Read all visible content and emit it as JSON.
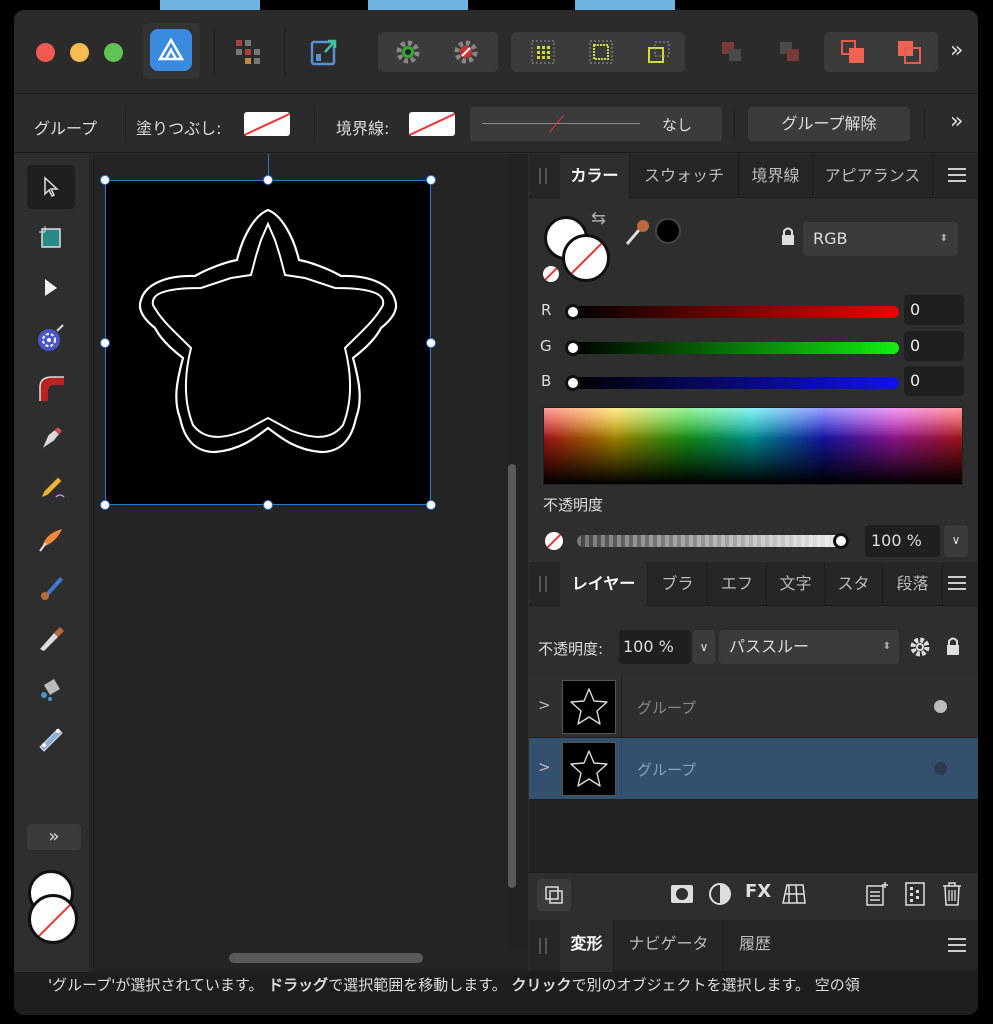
{
  "toolbar": {
    "overflow_label": "»"
  },
  "context_bar": {
    "object_label": "グループ",
    "fill_label": "塗りつぶし:",
    "stroke_label": "境界線:",
    "stroke_style_value": "なし",
    "ungroup_button": "グループ解除",
    "overflow_label": "»"
  },
  "tools": {
    "expand_label": "»"
  },
  "color_panel": {
    "tabs": [
      "カラー",
      "スウォッチ",
      "境界線",
      "アピアランス"
    ],
    "model": "RGB",
    "channels": [
      {
        "label": "R",
        "value": "0"
      },
      {
        "label": "G",
        "value": "0"
      },
      {
        "label": "B",
        "value": "0"
      }
    ],
    "opacity_label": "不透明度",
    "opacity_value": "100 %",
    "opacity_fraction": 1.0
  },
  "layers_panel": {
    "tabs": [
      "レイヤー",
      "ブラ",
      "エフ",
      "文字",
      "スタ",
      "段落"
    ],
    "opacity_label": "不透明度:",
    "opacity_value": "100 %",
    "blend_mode": "パススルー",
    "layers": [
      {
        "name": "グループ",
        "selected": false
      },
      {
        "name": "グループ",
        "selected": true
      }
    ]
  },
  "transform_panel": {
    "tabs": [
      "変形",
      "ナビゲータ",
      "履歴"
    ]
  },
  "status_bar": {
    "part1": "'グループ'が選択されています。 ",
    "bold1": "ドラッグ",
    "part2": "で選択範囲を移動します。 ",
    "bold2": "クリック",
    "part3": "で別のオブジェクトを選択します。 空の領"
  },
  "colors": {
    "accent": "#2d78d4",
    "selected_layer": "#34506f",
    "close": "#ee5a52",
    "minimize": "#f5bd4f",
    "zoom": "#5fc454"
  }
}
